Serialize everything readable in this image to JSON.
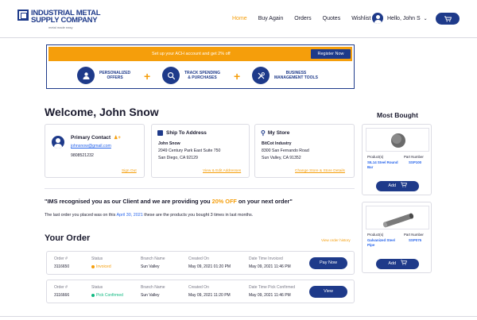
{
  "header": {
    "logo_line1": "INDUSTRIAL METAL",
    "logo_line2": "SUPPLY COMPANY",
    "logo_tagline": "metal made easy",
    "nav": [
      "Home",
      "Buy Again",
      "Orders",
      "Quotes",
      "Wishlist"
    ],
    "user_greeting": "Hello, John S",
    "cart_icon": "cart-icon"
  },
  "banner": {
    "message": "Set up your ACH account and get 2% off",
    "register_label": "Register Now",
    "features": [
      {
        "icon": "person-icon",
        "label_line1": "PERSONALIZED",
        "label_line2": "OFFERS"
      },
      {
        "icon": "search-icon",
        "label_line1": "TRACK SPENDING",
        "label_line2": "& PURCHASES"
      },
      {
        "icon": "tools-icon",
        "label_line1": "BUSINESS",
        "label_line2": "MANAGEMENT TOOLS"
      }
    ]
  },
  "welcome": "Welcome, John Snow",
  "contact": {
    "title": "Primary Contact",
    "email": "johnsnow@gmail.com",
    "phone": "9808521232",
    "sign_out": "Sign Out"
  },
  "ship_to": {
    "title": "Ship To Address",
    "name": "John Snow",
    "line1": "2049 Century Park East Suite 750",
    "line2": "San Diego, CA 92129",
    "link": "View & Edit Addresses"
  },
  "store": {
    "title": "My Store",
    "name": "BitCot Industry",
    "line1": "8300 San Fernando Road",
    "line2": "Sun Valley, CA 91352",
    "link": "Change Store & Store Details"
  },
  "promo": {
    "prefix": "\"IMS recognised you as our Client and we are providing you ",
    "highlight": "20% OFF",
    "suffix": " on your next order\""
  },
  "last_order": {
    "prefix": "The last order you placed was on this ",
    "date": "April 30, 2021",
    "suffix": " these are the products you bought 3 times in last months."
  },
  "orders_section": {
    "title": "Your Order",
    "history_link": "View order history",
    "labels": {
      "order": "Order #",
      "status": "Status",
      "branch": "Branch Name",
      "created": "Created On",
      "date_time": "Date Time Invoiced",
      "date_time_pick": "Date Time Pick Confirmed"
    },
    "rows": [
      {
        "order": "3116650",
        "status": "Invoiced",
        "branch": "Sun Valley",
        "created": "May 09, 2021 01:20 PM",
        "date_time": "May 09, 2021 11:46 PM",
        "button": "Pay Now",
        "status_color": "#f59e0b"
      },
      {
        "order": "3116666",
        "status": "Pick Confirmed",
        "branch": "Sun Valley",
        "created": "May 09, 2021 11:20 PM",
        "date_time": "May 09, 2021 11:46 PM",
        "button": "View",
        "status_color": "#10b981"
      }
    ]
  },
  "most_bought": {
    "title": "Most Bought",
    "product_header": "Product(s)",
    "part_header": "Part Number",
    "add_label": "Add",
    "items": [
      {
        "product_line1": "SIL14 Steel Round",
        "product_line2": "Bar",
        "part": "SSP100",
        "image": "round-bar-icon"
      },
      {
        "product_line1": "Galvanized Steel",
        "product_line2": "Pipe",
        "part": "SSP075",
        "image": "pipe-icon"
      }
    ]
  },
  "colors": {
    "brand": "#1e3a8a",
    "accent": "#f59e0b",
    "success": "#10b981",
    "link": "#2563eb"
  }
}
